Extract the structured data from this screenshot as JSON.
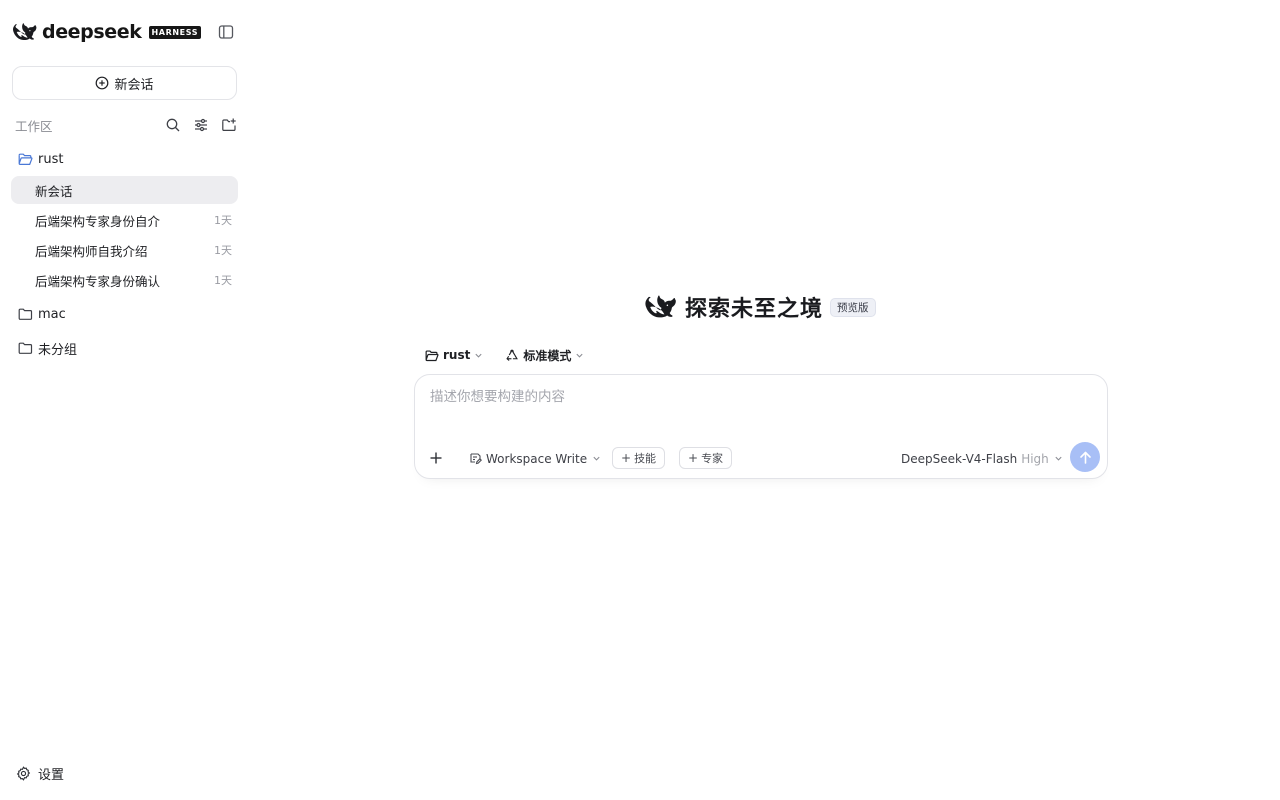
{
  "brand": {
    "name": "deepseek",
    "badge": "HARNESS"
  },
  "sidebar": {
    "new_chat_label": "新会话",
    "workspace_label": "工作区",
    "folders": [
      {
        "name": "rust",
        "open": true
      },
      {
        "name": "mac",
        "open": false
      },
      {
        "name": "未分组",
        "open": false
      }
    ],
    "sessions": [
      {
        "title": "新会话",
        "age": "",
        "active": true
      },
      {
        "title": "后端架构专家身份自介",
        "age": "1天",
        "active": false
      },
      {
        "title": "后端架构师自我介绍",
        "age": "1天",
        "active": false
      },
      {
        "title": "后端架构专家身份确认",
        "age": "1天",
        "active": false
      }
    ],
    "settings_label": "设置"
  },
  "hero": {
    "title": "探索未至之境",
    "badge": "预览版"
  },
  "context": {
    "folder": "rust",
    "mode": "标准模式"
  },
  "composer": {
    "placeholder": "描述你想要构建的内容",
    "value": "",
    "permission": "Workspace Write",
    "chip_skills": "技能",
    "chip_experts": "专家",
    "model": "DeepSeek-V4-Flash",
    "effort": "High"
  },
  "colors": {
    "accent": "#a8bff6",
    "folder_open": "#4a78d6",
    "active_row": "#ededf0"
  }
}
